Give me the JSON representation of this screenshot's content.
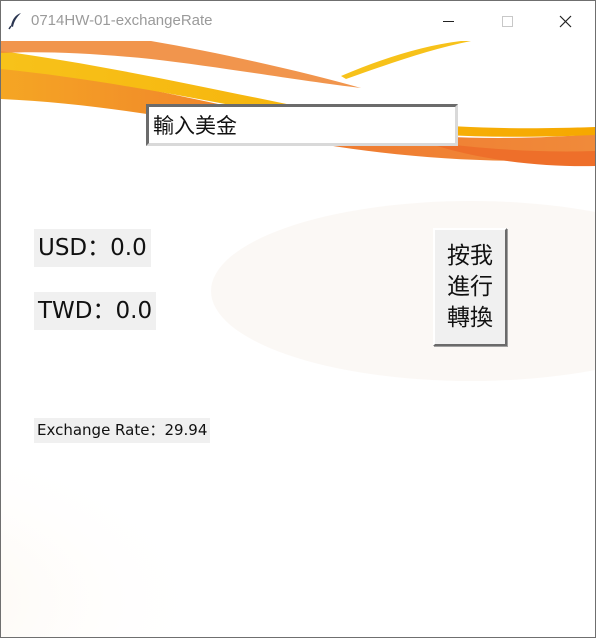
{
  "window": {
    "title": "0714HW-01-exchangeRate",
    "app_icon": "feather-icon",
    "controls": [
      "minimize-icon",
      "maximize-icon",
      "close-icon"
    ]
  },
  "input": {
    "value": "輸入美金"
  },
  "labels": {
    "usd": "USD：0.0",
    "twd": "TWD：0.0",
    "exchange_rate": "Exchange Rate：29.94"
  },
  "convert_button": {
    "lines": [
      "按我",
      "進行",
      "轉換"
    ]
  },
  "colors": {
    "accent_orange": "#ef7a2f",
    "accent_yellow": "#f5b800",
    "label_bg": "#f0f0f0"
  }
}
